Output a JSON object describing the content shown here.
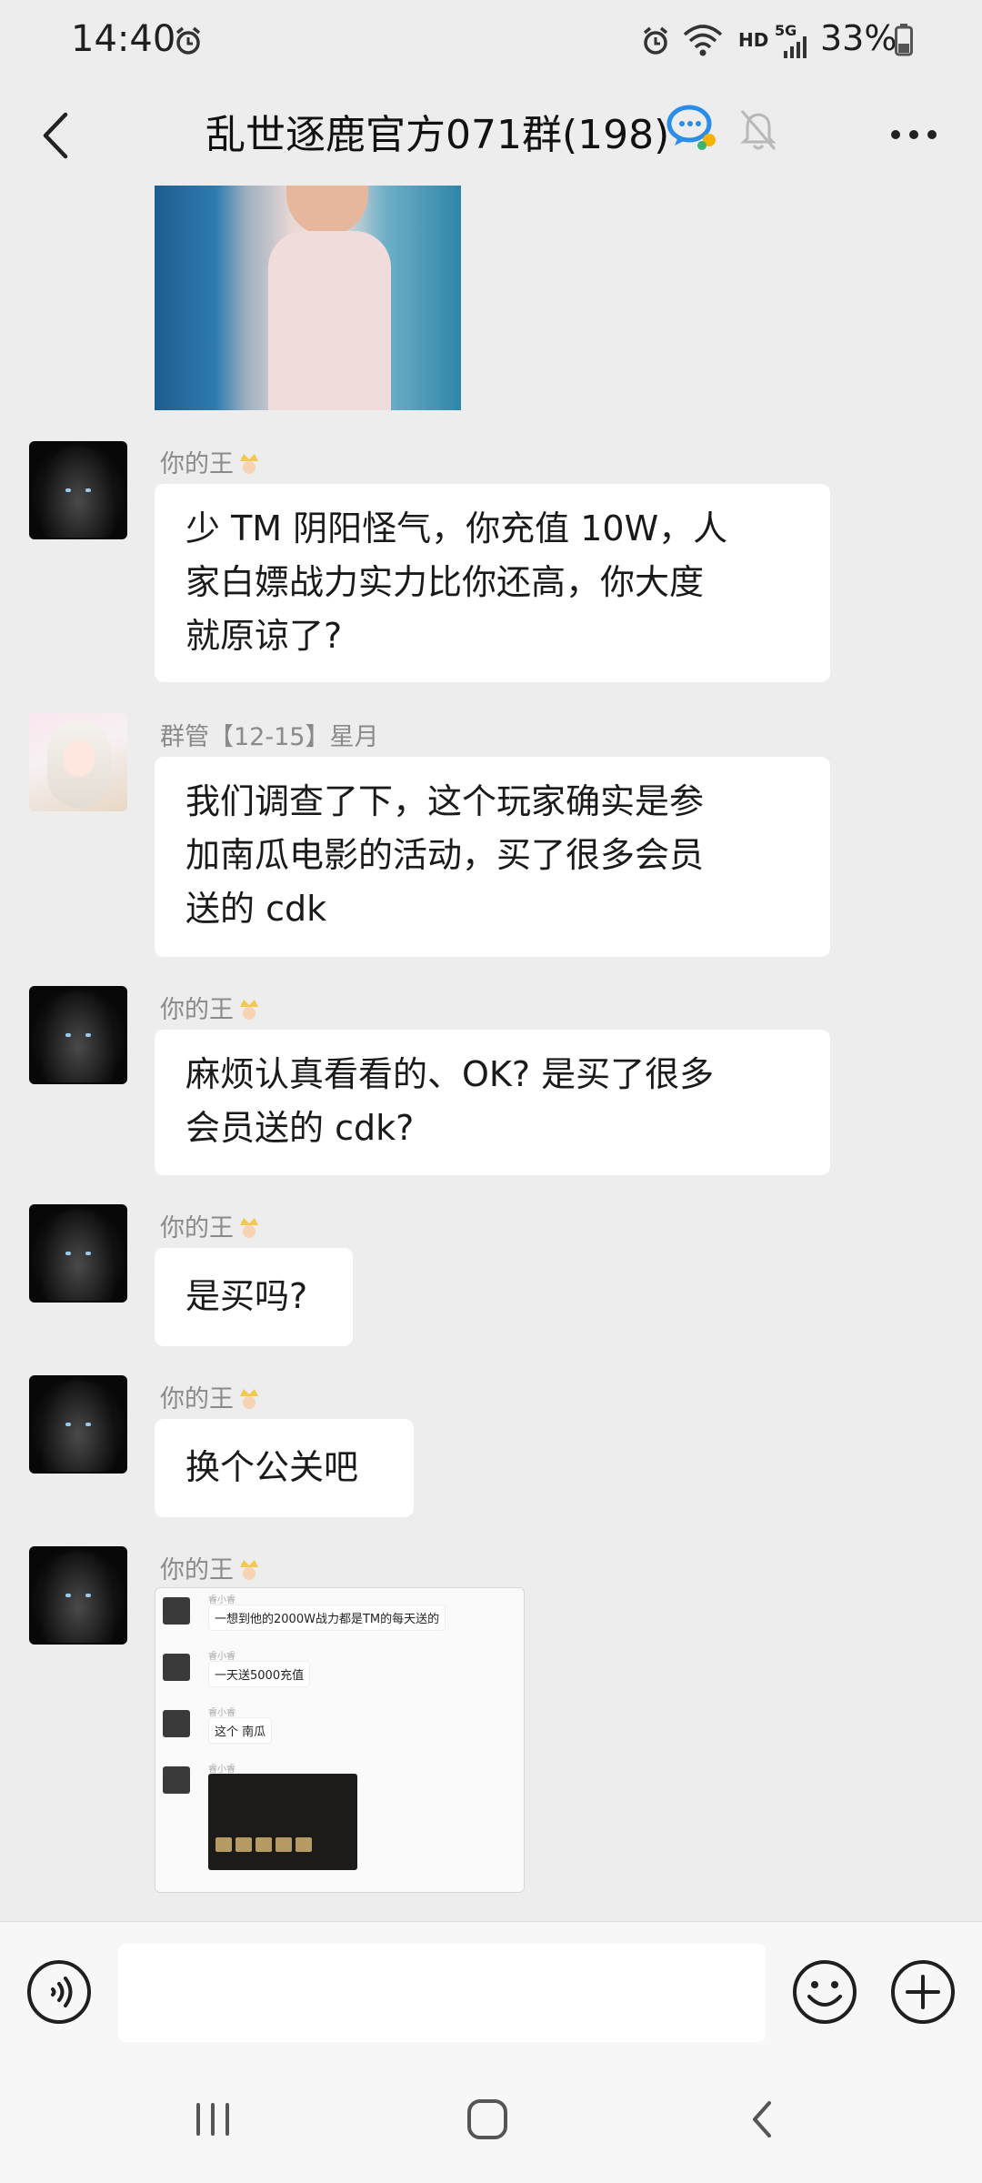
{
  "status_bar": {
    "time": "14:40",
    "network_hd": "HD",
    "network_gen": "5G",
    "battery": "33%"
  },
  "header": {
    "title": "乱世逐鹿官方071群(198)"
  },
  "messages": [
    {
      "sender": "你的王",
      "lines": [
        "少 TM 阴阳怪气，你充值 10W，人",
        "家白嫖战力实力比你还高，你大度",
        "就原谅了?"
      ]
    },
    {
      "sender": "群管【12-15】星月",
      "lines": [
        "我们调查了下，这个玩家确实是参",
        "加南瓜电影的活动，买了很多会员",
        "送的 cdk"
      ]
    },
    {
      "sender": "你的王",
      "lines": [
        "麻烦认真看看的、OK? 是买了很多",
        "会员送的 cdk?"
      ]
    },
    {
      "sender": "你的王",
      "lines": [
        "是买吗?"
      ]
    },
    {
      "sender": "你的王",
      "lines": [
        "换个公关吧"
      ]
    },
    {
      "sender": "你的王"
    }
  ],
  "screenshot_chat": {
    "name": "睿小睿",
    "lines": [
      "一想到他的2000W战力都是TM的每天送的",
      "一天送5000充值",
      "这个 南瓜"
    ]
  },
  "colors": {
    "background": "#ededed",
    "bubble": "#ffffff",
    "sender_text": "#8a8a8a"
  },
  "icons": {
    "back": "chevron-left-icon",
    "group_chat": "group-chat-icon",
    "mute": "bell-muted-icon",
    "more": "more-dots-icon",
    "voice": "voice-icon",
    "emoji": "emoji-icon",
    "plus": "plus-circle-icon",
    "nav_recents": "nav-recents-icon",
    "nav_home": "nav-home-icon",
    "nav_back": "nav-back-icon"
  }
}
